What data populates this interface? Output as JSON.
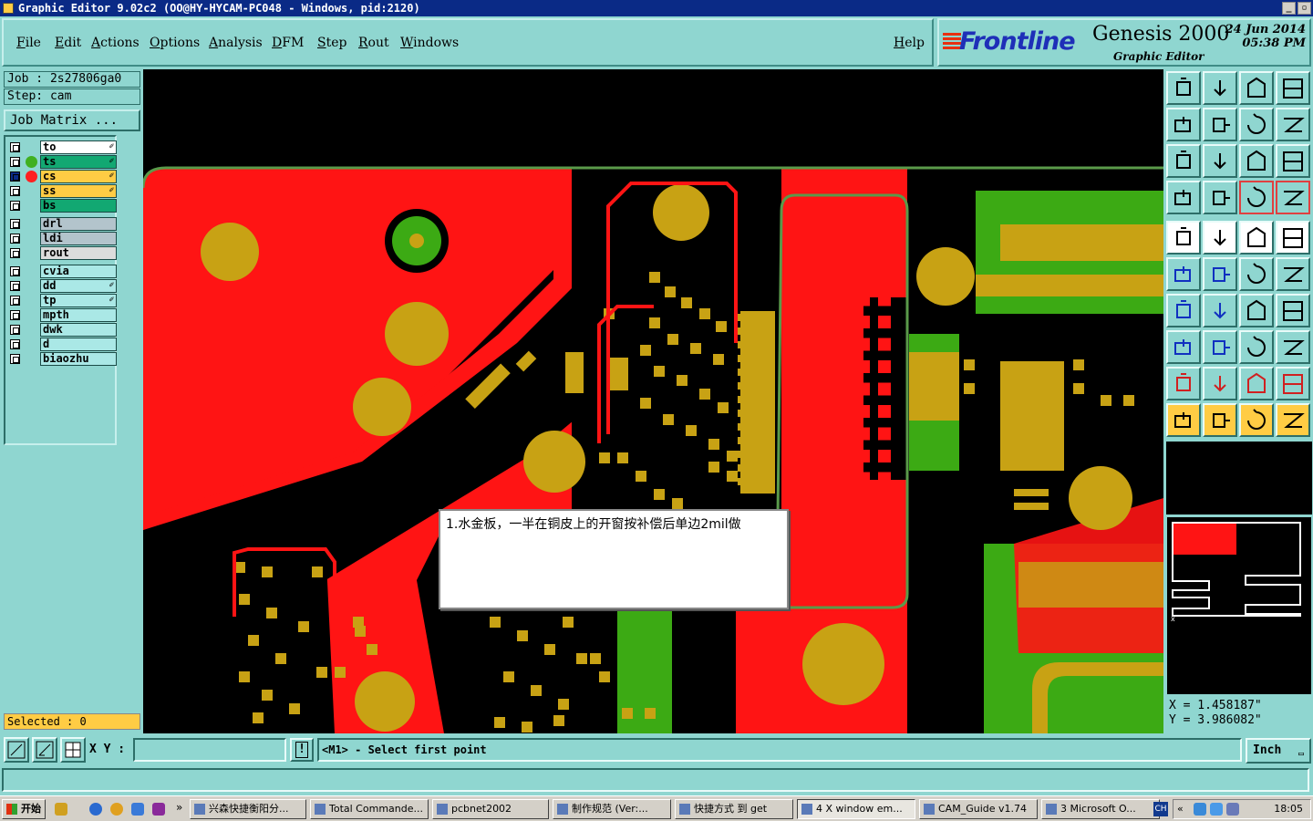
{
  "window": {
    "title": "Graphic Editor 9.02c2  (OO@HY-HYCAM-PC048 - Windows, pid:2120)"
  },
  "menu": {
    "items": [
      "File",
      "Edit",
      "Actions",
      "Options",
      "Analysis",
      "DFM",
      "Step",
      "Rout",
      "Windows"
    ],
    "help": "Help"
  },
  "brand": {
    "logo": "Frontline",
    "product": "Genesis 2000",
    "subtitle": "Graphic Editor",
    "date": "24 Jun 2014",
    "time": "05:38 PM"
  },
  "job": {
    "job_label": "Job : 2s27806ga0",
    "step_label": "Step: cam",
    "matrix_button": "Job Matrix ..."
  },
  "layers": [
    {
      "name": "to",
      "color": "#ffffff",
      "dot": "",
      "edit": true,
      "selected": false
    },
    {
      "name": "ts",
      "color": "#12a872",
      "dot": "#40b020",
      "edit": true,
      "selected": false
    },
    {
      "name": "cs",
      "color": "#ffcc44",
      "dot": "#ff2020",
      "edit": true,
      "selected": true
    },
    {
      "name": "ss",
      "color": "#ffcc44",
      "dot": "",
      "edit": true,
      "selected": false
    },
    {
      "name": "bs",
      "color": "#12a872",
      "dot": "",
      "edit": false,
      "selected": false
    },
    {
      "name": "drl",
      "color": "#b3c4cc",
      "dot": "",
      "edit": false,
      "selected": false
    },
    {
      "name": "ldi",
      "color": "#b3c4cc",
      "dot": "",
      "edit": false,
      "selected": false
    },
    {
      "name": "rout",
      "color": "#dcdcdc",
      "dot": "",
      "edit": false,
      "selected": false
    },
    {
      "name": "cvia",
      "color": "#aae8e6",
      "dot": "",
      "edit": false,
      "selected": false
    },
    {
      "name": "dd",
      "color": "#aae8e6",
      "dot": "",
      "edit": true,
      "selected": false
    },
    {
      "name": "tp",
      "color": "#aae8e6",
      "dot": "",
      "edit": true,
      "selected": false
    },
    {
      "name": "mpth",
      "color": "#aae8e6",
      "dot": "",
      "edit": false,
      "selected": false
    },
    {
      "name": "dwk",
      "color": "#aae8e6",
      "dot": "",
      "edit": false,
      "selected": false
    },
    {
      "name": "d",
      "color": "#aae8e6",
      "dot": "",
      "edit": false,
      "selected": false
    },
    {
      "name": "biaozhu",
      "color": "#aae8e6",
      "dot": "",
      "edit": false,
      "selected": false
    }
  ],
  "selected_count": "Selected : 0",
  "note": {
    "text": "1.水金板，一半在铜皮上的开窗按补偿后单边2mil做"
  },
  "coords": {
    "x": "X  =  1.458187\"",
    "y": "Y  =  3.986082\""
  },
  "command": {
    "xy_label": "X Y :",
    "xy_value": "",
    "prompt": "<M1> - Select first point",
    "units": "Inch"
  },
  "colors": {
    "copper_red": "#ff1414",
    "pad_gold": "#c8a214",
    "mask_green": "#3caa14",
    "outline_green": "#5a9a4a",
    "background": "#000000"
  },
  "taskbar": {
    "start": "开始",
    "tasks": [
      "兴森快捷衡阳分...",
      "Total Commande...",
      "pcbnet2002",
      "制作规范 (Ver:...",
      "快捷方式 到 get",
      "4 X window em...",
      "CAM_Guide v1.74",
      "3 Microsoft O..."
    ],
    "lang": "CH",
    "clock": "18:05"
  }
}
